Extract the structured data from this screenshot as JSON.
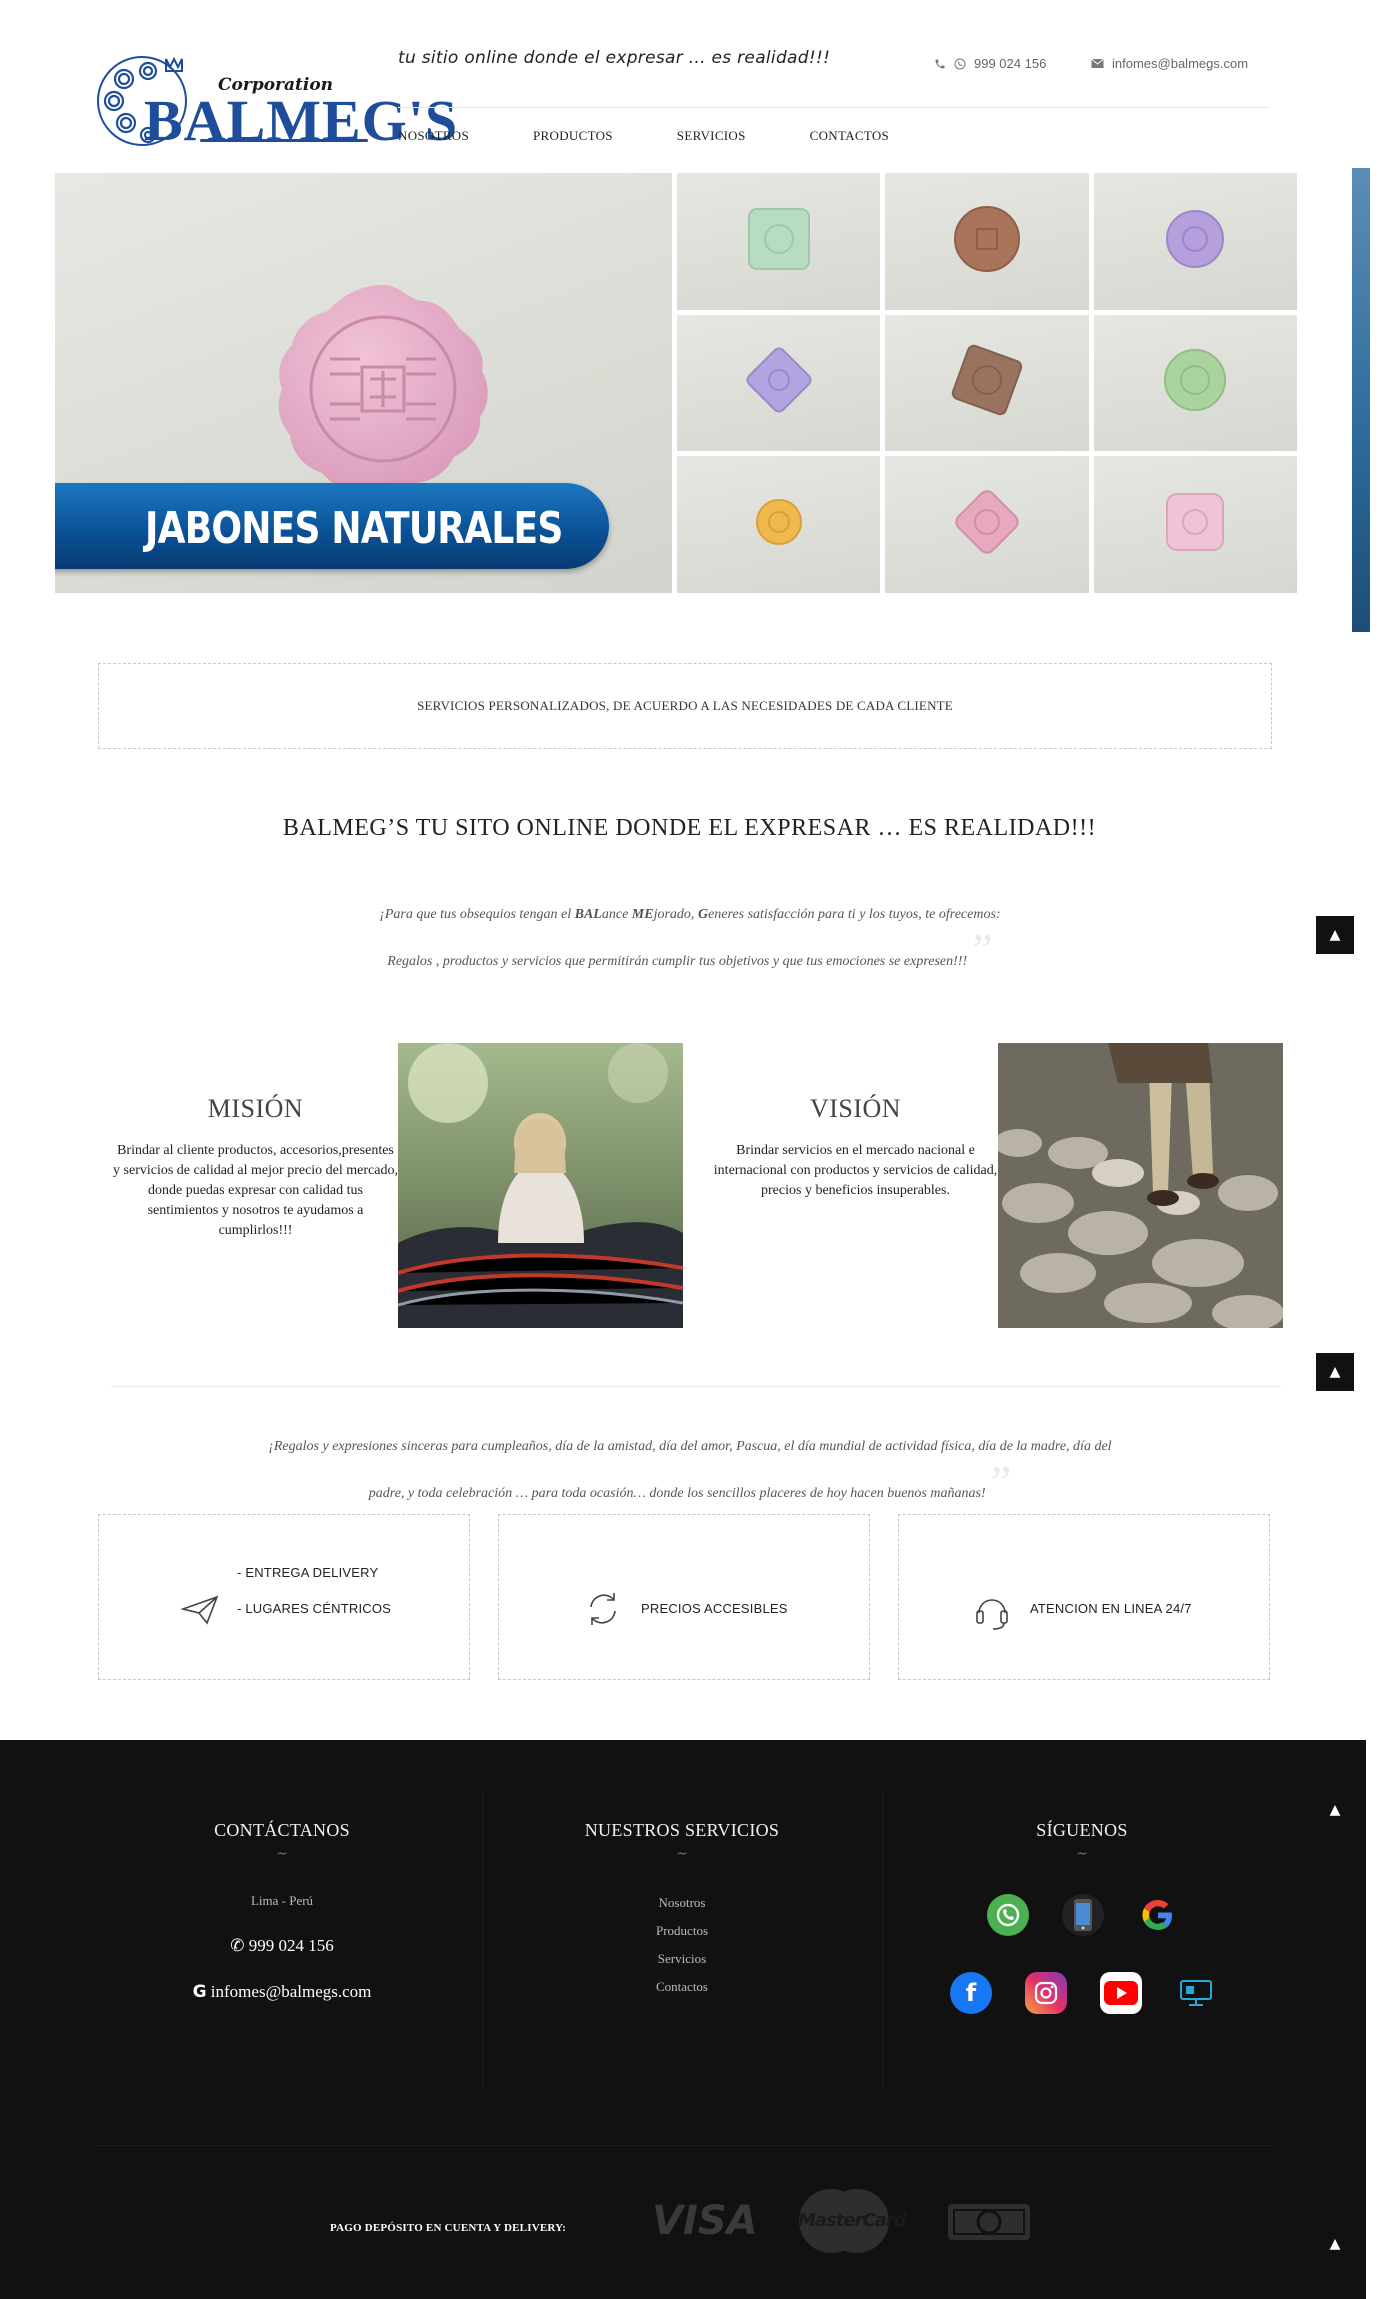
{
  "header": {
    "brand_sub": "Corporation",
    "brand_main": "BALMEG'S",
    "tagline": "tu sitio online donde el expresar ... es realidad!!!",
    "phone": "999 024 156",
    "email": "infomes@balmegs.com"
  },
  "nav": {
    "items": [
      "NOSOTROS",
      "PRODUCTOS",
      "SERVICIOS",
      "CONTACTOS"
    ]
  },
  "hero": {
    "banner_text": "JABONES NATURALES"
  },
  "services_strip": "SERVICIOS PERSONALIZADOS, DE ACUERDO A LAS NECESIDADES DE CADA CLIENTE",
  "main_title": "BALMEG’S TU SITO ONLINE DONDE EL EXPRESAR … ES REALIDAD!!!",
  "quote1": {
    "part_a": "¡Para que tus obsequios tengan el ",
    "bold_a": "BAL",
    "part_b": "ance ",
    "bold_b": "ME",
    "part_c": "jorado, ",
    "bold_c": "G",
    "part_d": "eneres satisfacción para ti y los tuyos, te ofrecemos:",
    "line2": "Regalos , productos y servicios que permitirán cumplir tus objetivos y que tus emociones se expresen!!!"
  },
  "mission": {
    "title": "MISIÓN",
    "text": "Brindar al cliente productos, accesorios,presentes y servicios de calidad al mejor precio del mercado, donde puedas expresar con calidad tus sentimientos y nosotros te ayudamos a cumplirlos!!!"
  },
  "vision": {
    "title": "VISIÓN",
    "text": "Brindar servicios en el mercado nacional e internacional con productos y servicios de calidad, precios y beneficios insuperables."
  },
  "quote2": {
    "line1": "¡Regalos y expresiones sinceras para cumpleaños, día de la amistad, día del amor, Pascua, el día mundial de actividad física, día de la madre, día del",
    "line2": "padre, y toda celebración … para toda ocasión… donde los sencillos placeres de hoy hacen buenos mañanas!"
  },
  "features": {
    "delivery_1": "- ENTREGA DELIVERY",
    "delivery_2": "- LUGARES CÉNTRICOS",
    "prices": "PRECIOS ACCESIBLES",
    "support": "ATENCION EN LINEA 24/7"
  },
  "footer": {
    "contact_title": "CONTÁCTANOS",
    "location": "Lima - Perú",
    "phone": "999 024 156",
    "email": "infomes@balmegs.com",
    "services_title": "NUESTROS SERVICIOS",
    "services_links": [
      "Nosotros",
      "Productos",
      "Servicios",
      "Contactos"
    ],
    "follow_title": "SÍGUENOS",
    "payment_label": "PAGO DEPÓSITO EN CUENTA Y DELIVERY:",
    "payment_visa": "VISA",
    "payment_mastercard": "MasterCard"
  },
  "colors": {
    "brand_blue": "#1e4d9c",
    "banner_blue": "#0b4f94",
    "footer_bg": "#111111",
    "whatsapp": "#4caf50",
    "google_red": "#ea4335",
    "facebook": "#1877f2",
    "instagram": "#e1306c",
    "youtube": "#ff0000"
  },
  "icons": {
    "phone": "phone-icon",
    "whatsapp": "whatsapp-icon",
    "email": "envelope-icon",
    "up": "arrow-up-icon",
    "delivery": "paper-plane-icon",
    "prices": "refresh-icon",
    "support": "headset-icon"
  }
}
